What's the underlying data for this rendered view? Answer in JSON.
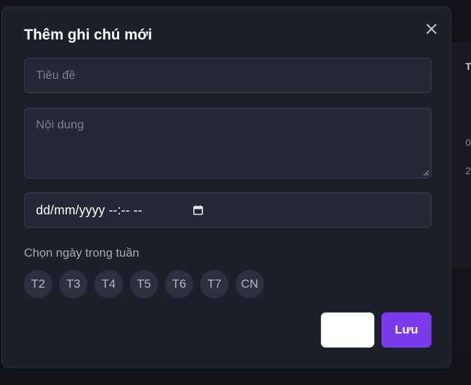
{
  "background": {
    "table_header_fragment": "T",
    "row_fragments": [
      "0",
      "2"
    ]
  },
  "modal": {
    "title": "Thêm ghi chú mới",
    "close_icon": "close-icon",
    "title_input": {
      "placeholder": "Tiêu đề",
      "value": ""
    },
    "content_input": {
      "placeholder": "Nội dung",
      "value": ""
    },
    "datetime_input": {
      "display": "dd/mm/yyyy --:-- --",
      "icon": "calendar-icon"
    },
    "weekday_label": "Chọn ngày trong tuần",
    "weekdays": [
      "T2",
      "T3",
      "T4",
      "T5",
      "T6",
      "T7",
      "CN"
    ],
    "cancel_label": "",
    "save_label": "Lưu"
  },
  "colors": {
    "modal_bg": "#1d1f2a",
    "input_bg": "#262837",
    "chip_bg": "#2d3040",
    "accent": "#7c3aed"
  }
}
